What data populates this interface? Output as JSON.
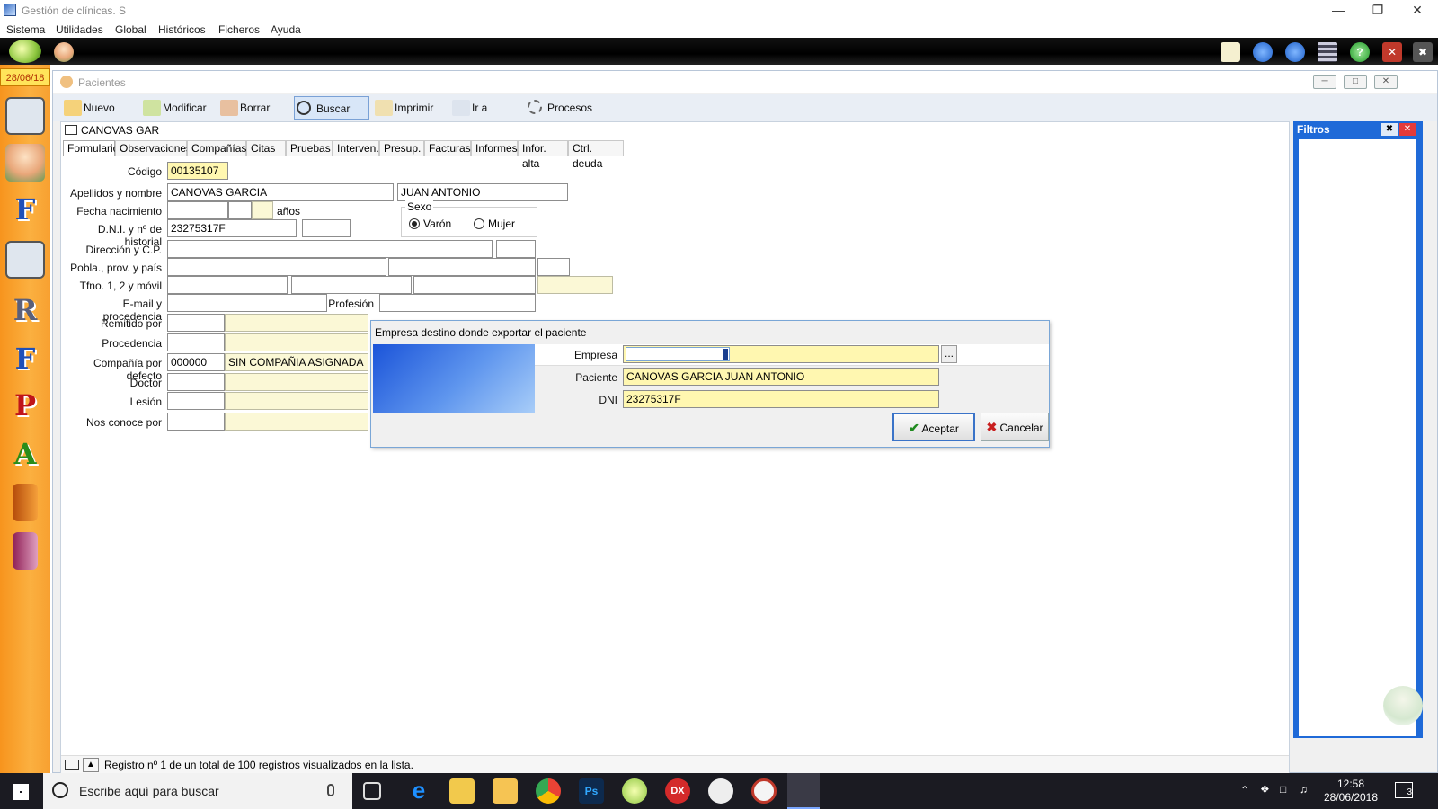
{
  "window": {
    "title": "Gestión de clínicas. S"
  },
  "menu": [
    "Sistema",
    "Utilidades",
    "Global",
    "Históricos",
    "Ficheros",
    "Ayuda"
  ],
  "sidebar": {
    "date": "28/06/18",
    "letters": [
      "F",
      "R",
      "F",
      "P",
      "A"
    ]
  },
  "patients": {
    "title": "Pacientes",
    "toolbar": [
      "Nuevo",
      "Modificar",
      "Borrar",
      "Buscar",
      "Imprimir",
      "Ir a",
      "Procesos"
    ],
    "header": "CANOVAS GAR",
    "tabs": [
      "Formulario",
      "Observaciones",
      "Compañías",
      "Citas",
      "Pruebas",
      "Interven.",
      "Presup.",
      "Facturas",
      "Informes",
      "Infor. alta",
      "Ctrl. deuda"
    ],
    "labels": {
      "codigo": "Código",
      "apellidos": "Apellidos y nombre",
      "fecha": "Fecha nacimiento",
      "anos": "años",
      "dni": "D.N.I. y nº de historial",
      "direccion": "Dirección y C.P.",
      "pobla": "Pobla., prov. y país",
      "tfno": "Tfno. 1, 2 y móvil",
      "email": "E-mail y procedencia",
      "profesion": "Profesión",
      "remitido": "Remitido por",
      "procedencia": "Procedencia",
      "compania": "Compañía por defecto",
      "doctor": "Doctor",
      "lesion": "Lesión",
      "nosconoce": "Nos conoce por",
      "sexo": "Sexo",
      "varon": "Varón",
      "mujer": "Mujer"
    },
    "values": {
      "codigo": "00135107",
      "apellidos": "CANOVAS GARCIA",
      "nombre": "JUAN ANTONIO",
      "dni": "23275317F",
      "compania_code": "000000",
      "compania_name": "SIN COMPAÑIA ASIGNADA"
    },
    "status": "Registro nº 1 de un total de 100 registros visualizados en la lista."
  },
  "filters": {
    "title": "Filtros"
  },
  "dialog": {
    "title": "Empresa destino donde exportar el paciente",
    "empresa_label": "Empresa",
    "empresa_value": "",
    "browse": "...",
    "paciente_label": "Paciente",
    "paciente_value": "CANOVAS GARCIA JUAN ANTONIO",
    "dni_label": "DNI",
    "dni_value": "23275317F",
    "accept": "Aceptar",
    "cancel": "Cancelar"
  },
  "taskbar": {
    "search_placeholder": "Escribe aquí para buscar",
    "time": "12:58",
    "date": "28/06/2018",
    "notifications": "3"
  },
  "colors": {
    "sidebar": "#f7941d",
    "filters": "#1f6ad8",
    "field_yellow": "#fbf8d6"
  }
}
